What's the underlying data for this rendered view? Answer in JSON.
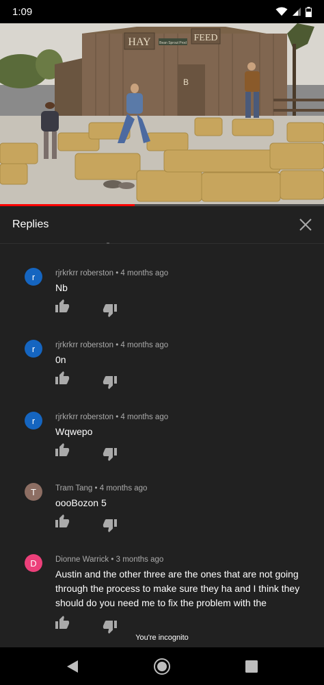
{
  "status_bar": {
    "time": "1:09",
    "icons": [
      "wifi-icon",
      "signal-icon",
      "battery-icon"
    ]
  },
  "video": {
    "sign_left": "HAY",
    "sign_right": "FEED",
    "sign_small": "Bean Sprout Prod",
    "progress_fraction": 0.415,
    "progress_color": "#ff0000"
  },
  "replies_panel": {
    "title": "Replies",
    "close_icon": "close-icon",
    "comments": [
      {
        "avatar_letter": "r",
        "avatar_color": "#1565c0",
        "author": "rjrkrkrr roberston",
        "time": "4 months ago",
        "text": "Nb"
      },
      {
        "avatar_letter": "r",
        "avatar_color": "#1565c0",
        "author": "rjrkrkrr roberston",
        "time": "4 months ago",
        "text": "0n"
      },
      {
        "avatar_letter": "r",
        "avatar_color": "#1565c0",
        "author": "rjrkrkrr roberston",
        "time": "4 months ago",
        "text": "Wqwepo"
      },
      {
        "avatar_letter": "T",
        "avatar_color": "#8d6e63",
        "author": "Tram Tang",
        "time": "4 months ago",
        "text": "oooBozon 5"
      },
      {
        "avatar_letter": "D",
        "avatar_color": "#ec407a",
        "author": "Dionne Warrick",
        "time": "3 months ago",
        "text": "Austin and the other three are the ones that are not going through the process to make sure they ha and I think they should do you need me to fix the problem with the"
      }
    ],
    "separator": "•",
    "like_icon": "thumbs-up-icon",
    "dislike_icon": "thumbs-down-icon"
  },
  "incognito_label": "You're incognito",
  "nav_bar": {
    "buttons": [
      "back-icon",
      "home-icon",
      "recents-icon"
    ]
  }
}
